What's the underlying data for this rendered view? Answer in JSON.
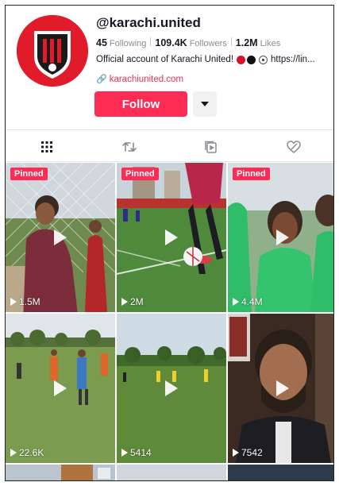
{
  "profile": {
    "username": "@karachi.united",
    "following_count": "45",
    "following_label": "Following",
    "followers_count": "109.4K",
    "followers_label": "Followers",
    "likes_count": "1.2M",
    "likes_label": "Likes",
    "bio": "Official account of Karachi United!",
    "bio_link_text": "https://lin...",
    "website": "karachiunited.com",
    "follow_label": "Follow"
  },
  "tabs": [
    {
      "name": "videos",
      "icon": "grid-icon"
    },
    {
      "name": "reposts",
      "icon": "repost-icon"
    },
    {
      "name": "playlists",
      "icon": "playlist-icon"
    },
    {
      "name": "liked",
      "icon": "liked-icon"
    }
  ],
  "videos": [
    {
      "views": "1.5M",
      "pinned": true,
      "pinned_label": "Pinned"
    },
    {
      "views": "2M",
      "pinned": true,
      "pinned_label": "Pinned"
    },
    {
      "views": "4.4M",
      "pinned": true,
      "pinned_label": "Pinned"
    },
    {
      "views": "22.6K",
      "pinned": false
    },
    {
      "views": "5414",
      "pinned": false
    },
    {
      "views": "7542",
      "pinned": false
    }
  ],
  "colors": {
    "accent": "#fe2c55",
    "link": "#e0335b",
    "brand_red": "#e21b2a"
  }
}
